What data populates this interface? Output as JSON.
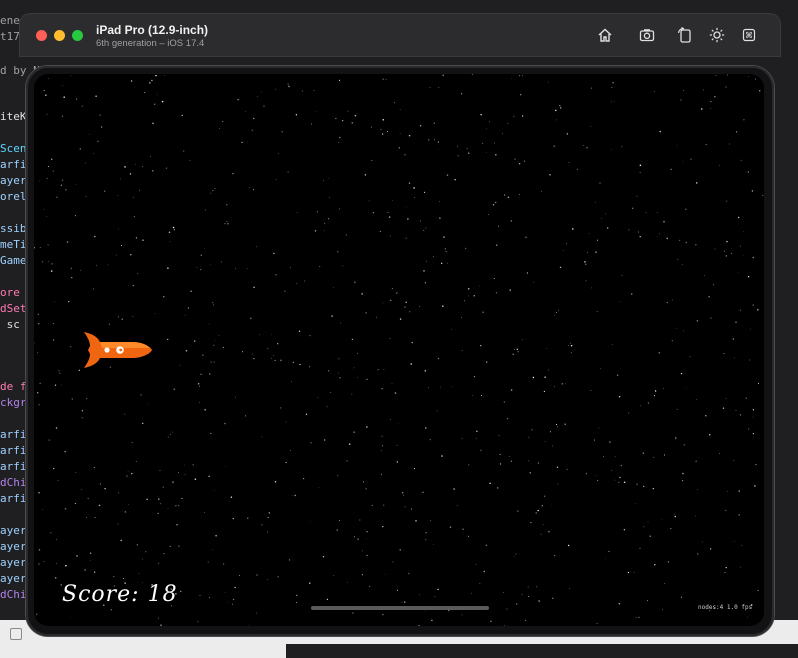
{
  "simulator": {
    "title": "iPad Pro (12.9-inch)",
    "subtitle": "6th generation – iOS 17.4",
    "toolbar": [
      "home-icon",
      "screenshot-icon",
      "rotate-icon",
      "appearance-icon",
      "keyboard-icon"
    ]
  },
  "game": {
    "score_text": "Score: 18",
    "stats_text": "nodes:4  1.0 fps"
  },
  "code_fragments": [
    {
      "text": "ene",
      "color": "#a0a0a0"
    },
    {
      "text": "t17",
      "color": "#a0a0a0"
    },
    {
      "text": "d by N",
      "color": "#a0a0a0"
    },
    {
      "text": "iteK",
      "color": "#e0e0e0"
    },
    {
      "text": "Scen",
      "color": "#5dd8ff"
    },
    {
      "text": "arfi",
      "color": "#9ed2ff"
    },
    {
      "text": "ayer",
      "color": "#9ed2ff"
    },
    {
      "text": "orel",
      "color": "#9ed2ff"
    },
    {
      "text": "ssib",
      "color": "#9ed2ff"
    },
    {
      "text": "meTi",
      "color": "#9ed2ff"
    },
    {
      "text": "Game",
      "color": "#9ed2ff"
    },
    {
      "text": "ore",
      "color": "#ff7ab2"
    },
    {
      "text": "dSet",
      "color": "#ff7ab2"
    },
    {
      "text": " sc",
      "color": "#e0e0e0"
    },
    {
      "text": "de f",
      "color": "#ff7ab2"
    },
    {
      "text": "ckgr",
      "color": "#b281eb"
    },
    {
      "text": "arfi",
      "color": "#9ed2ff"
    },
    {
      "text": "arfi",
      "color": "#9ed2ff"
    },
    {
      "text": "arfi",
      "color": "#9ed2ff"
    },
    {
      "text": "dChi",
      "color": "#b281eb"
    },
    {
      "text": "arfi",
      "color": "#9ed2ff"
    },
    {
      "text": "ayer",
      "color": "#9ed2ff"
    },
    {
      "text": "ayer",
      "color": "#9ed2ff"
    },
    {
      "text": "ayer",
      "color": "#9ed2ff"
    },
    {
      "text": "ayer",
      "color": "#9ed2ff"
    },
    {
      "text": "dChi",
      "color": "#b281eb"
    }
  ]
}
